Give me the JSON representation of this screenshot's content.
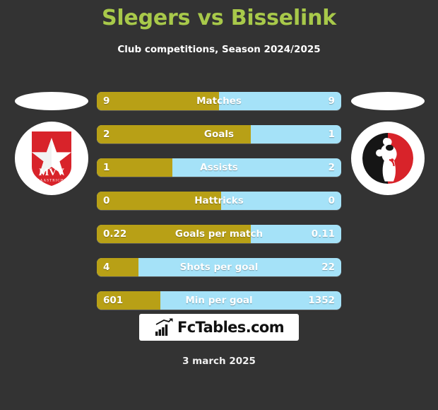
{
  "header": {
    "title": "Slegers vs Bisselink",
    "subtitle": "Club competitions, Season 2024/2025",
    "title_color": "#a8c94a"
  },
  "teams": {
    "left": {
      "crest_name": "mvv-maastricht-crest",
      "crest_primary_text": "MVV",
      "crest_secondary_text": "MAASTRICHT",
      "crest_color": "#d8232a"
    },
    "right": {
      "crest_name": "helmond-sport-crest",
      "crest_colors": [
        "#1a1a1a",
        "#d8232a"
      ]
    }
  },
  "colors": {
    "background": "#333333",
    "left_bar": "#b8a016",
    "right_bar": "#a5e2f8",
    "text": "#ffffff"
  },
  "chart_data": {
    "type": "bar",
    "title": "Slegers vs Bisselink",
    "subtitle": "Club competitions, Season 2024/2025",
    "orientation": "horizontal-diverging",
    "series": [
      {
        "name": "Slegers",
        "color": "#b8a016",
        "values": [
          "9",
          "2",
          "1",
          "0",
          "0.22",
          "4",
          "601"
        ]
      },
      {
        "name": "Bisselink",
        "color": "#a5e2f8",
        "values": [
          "9",
          "1",
          "2",
          "0",
          "0.11",
          "22",
          "1352"
        ]
      }
    ],
    "categories": [
      "Matches",
      "Goals",
      "Assists",
      "Hattricks",
      "Goals per match",
      "Shots per goal",
      "Min per goal"
    ],
    "rows": [
      {
        "label": "Matches",
        "left": "9",
        "right": "9",
        "left_pct": 50
      },
      {
        "label": "Goals",
        "left": "2",
        "right": "1",
        "left_pct": 63
      },
      {
        "label": "Assists",
        "left": "1",
        "right": "2",
        "left_pct": 31
      },
      {
        "label": "Hattricks",
        "left": "0",
        "right": "0",
        "left_pct": 51
      },
      {
        "label": "Goals per match",
        "left": "0.22",
        "right": "0.11",
        "left_pct": 63
      },
      {
        "label": "Shots per goal",
        "left": "4",
        "right": "22",
        "left_pct": 17
      },
      {
        "label": "Min per goal",
        "left": "601",
        "right": "1352",
        "left_pct": 26
      }
    ]
  },
  "footer": {
    "logo_text": "FcTables.com",
    "logo_icon": "bar-chart-arrow-icon",
    "date": "3 march 2025"
  }
}
